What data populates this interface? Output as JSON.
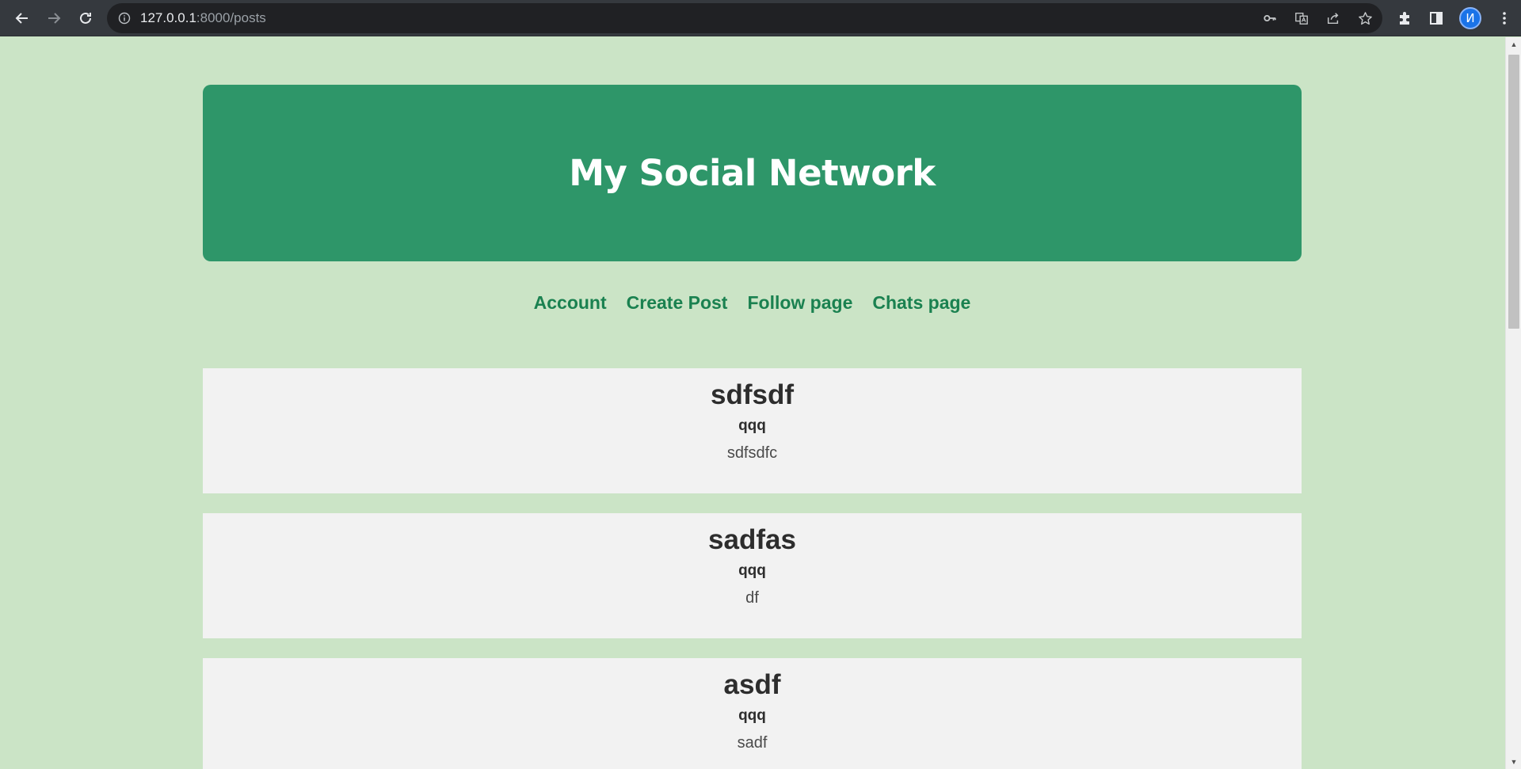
{
  "browser": {
    "url_host": "127.0.0.1",
    "url_path": ":8000/posts",
    "profile_initial": "И"
  },
  "site": {
    "title": "My Social Network"
  },
  "nav": [
    {
      "label": "Account"
    },
    {
      "label": "Create Post"
    },
    {
      "label": "Follow page"
    },
    {
      "label": "Chats page"
    }
  ],
  "posts": [
    {
      "title": "sdfsdf",
      "author": "qqq",
      "body": "sdfsdfc"
    },
    {
      "title": "sadfas",
      "author": "qqq",
      "body": "df"
    },
    {
      "title": "asdf",
      "author": "qqq",
      "body": "sadf"
    }
  ],
  "colors": {
    "page_bg": "#cbe4c6",
    "banner_bg": "#2e9669",
    "link": "#1a8150",
    "card_bg": "#f2f2f2"
  }
}
